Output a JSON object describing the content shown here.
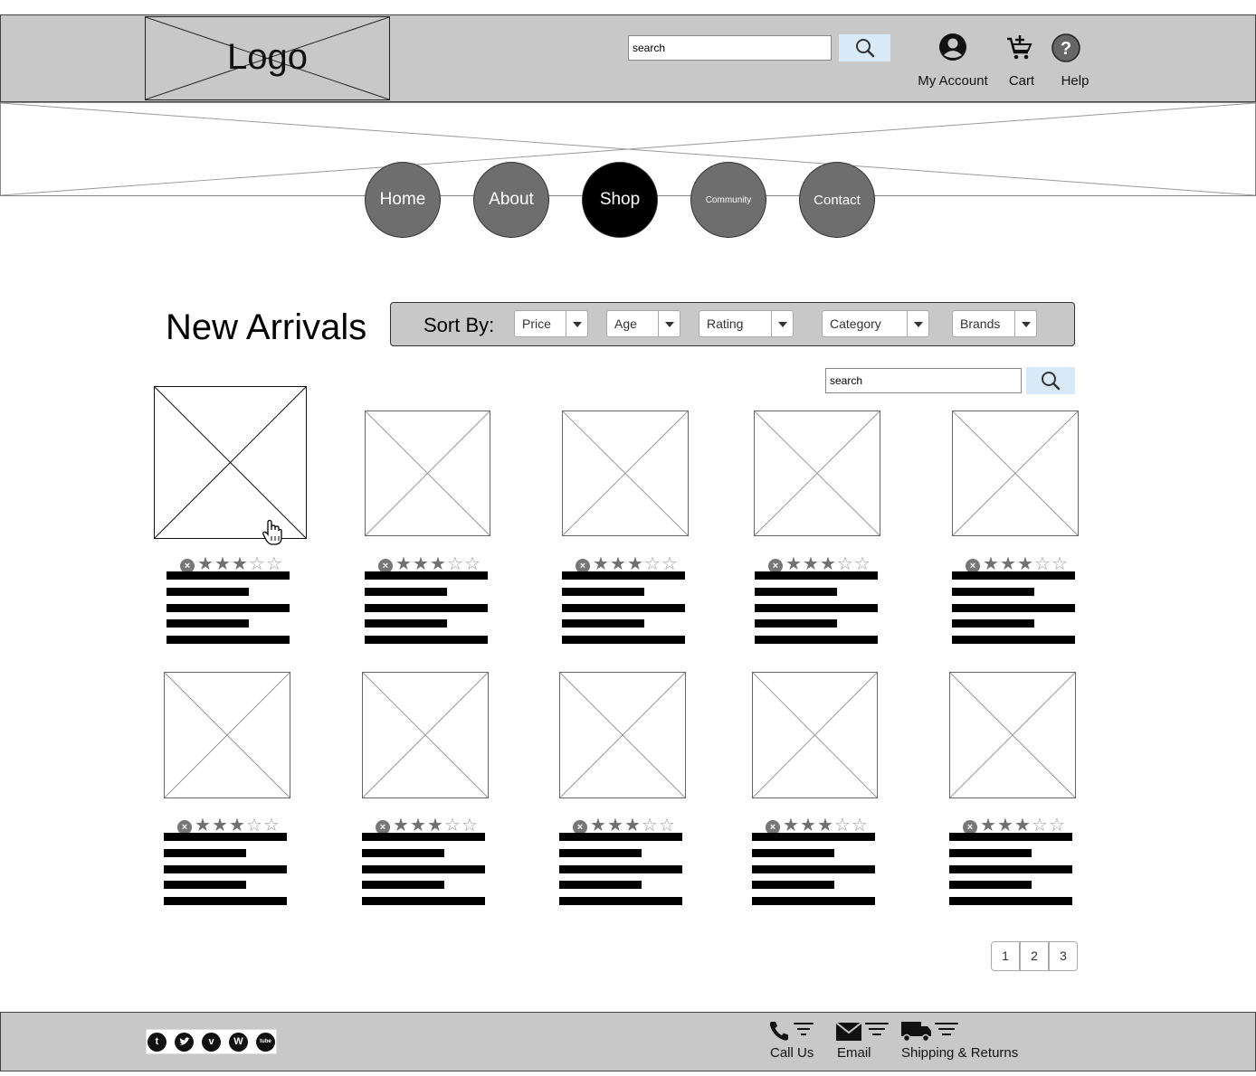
{
  "header": {
    "logo_text": "Logo",
    "search": {
      "placeholder": "search",
      "value": "search"
    },
    "actions": [
      {
        "label": "My Account",
        "icon": "account-circle-icon"
      },
      {
        "label": "Cart",
        "icon": "cart-add-icon"
      },
      {
        "label": "Help",
        "icon": "help-circle-icon"
      }
    ]
  },
  "nav": {
    "items": [
      {
        "label": "Home",
        "active": false
      },
      {
        "label": "About",
        "active": false
      },
      {
        "label": "Shop",
        "active": true
      },
      {
        "label": "Community",
        "active": false
      },
      {
        "label": "Contact",
        "active": false
      }
    ]
  },
  "main": {
    "title": "New Arrivals",
    "sort": {
      "label": "Sort By:",
      "options": [
        {
          "label": "Price"
        },
        {
          "label": "Age"
        },
        {
          "label": "Rating"
        },
        {
          "label": "Category"
        },
        {
          "label": "Brands"
        }
      ]
    },
    "search": {
      "value": "search"
    },
    "products": {
      "rating_stars": 3,
      "rating_max": 5,
      "count": 10
    },
    "pagination": [
      "1",
      "2",
      "3"
    ]
  },
  "footer": {
    "social": [
      "t",
      "twitter",
      "v",
      "W",
      "tube"
    ],
    "contacts": [
      {
        "label": "Call Us",
        "icon": "phone-icon"
      },
      {
        "label": "Email",
        "icon": "envelope-icon"
      },
      {
        "label": "Shipping & Returns",
        "icon": "truck-icon"
      }
    ]
  },
  "colors": {
    "bar_bg": "#c8c8c8",
    "nav_circle": "#6e6e6e",
    "nav_active": "#000000",
    "search_button": "#d8e9f8"
  }
}
